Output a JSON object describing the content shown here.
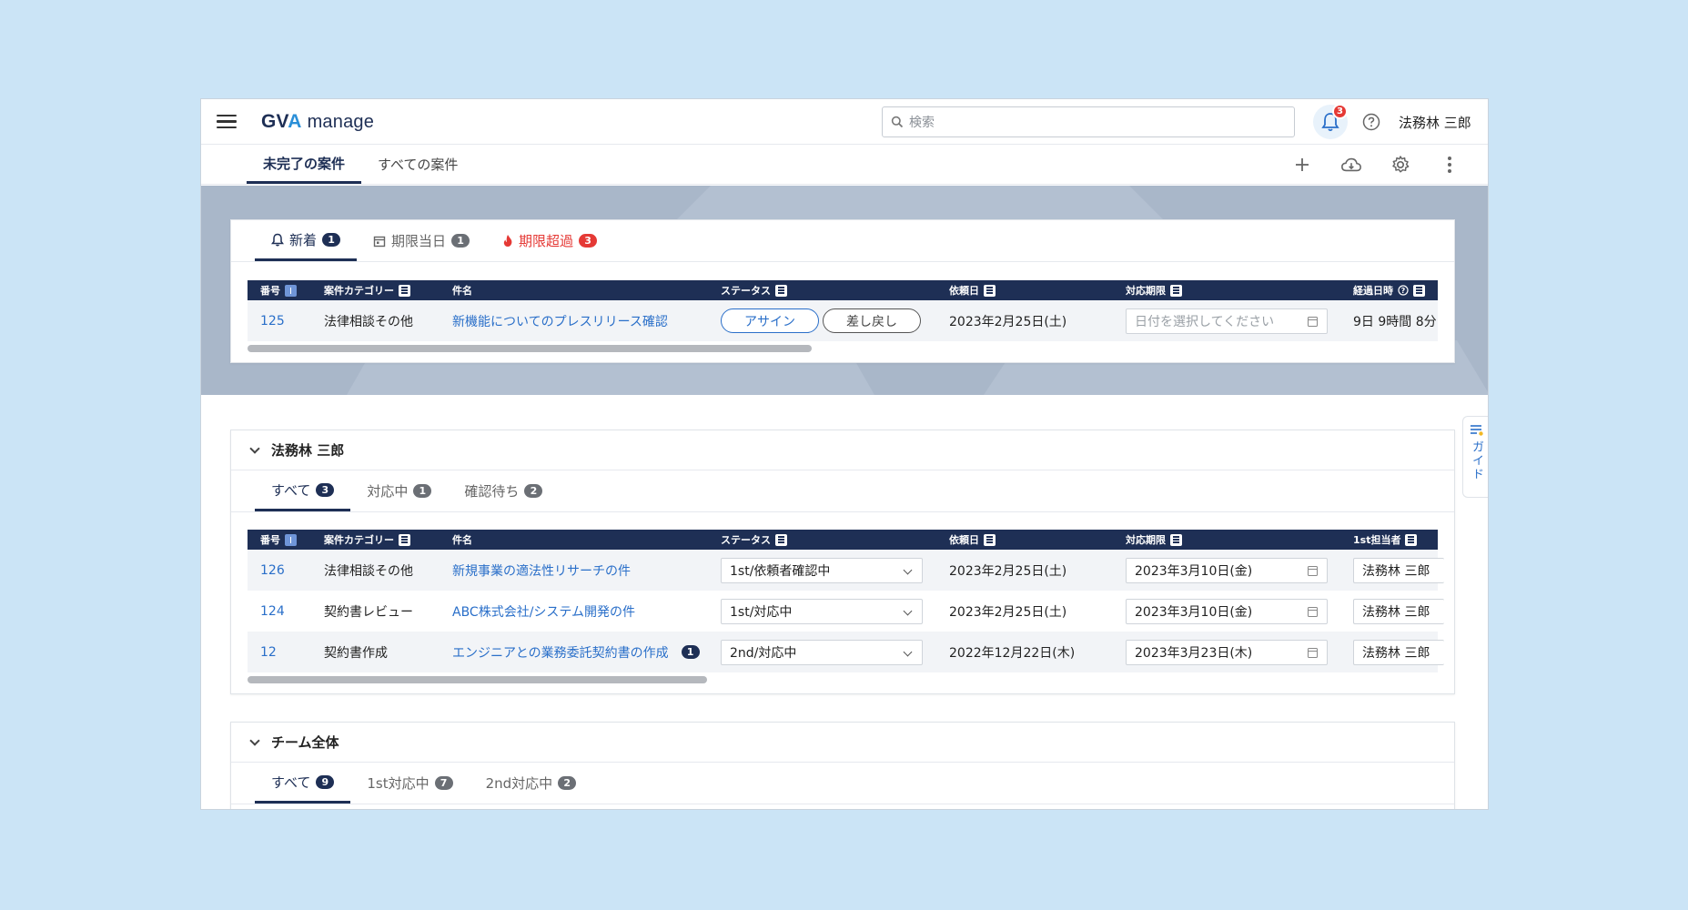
{
  "app": {
    "logo_gv": "GV",
    "logo_a": "A",
    "logo_manage": "manage",
    "search_placeholder": "検索",
    "notification_count": "3",
    "user_name": "法務林 三郎"
  },
  "main_tabs": [
    {
      "label": "未完了の案件",
      "active": true
    },
    {
      "label": "すべての案件",
      "active": false
    }
  ],
  "toolbar": {
    "icons": [
      "plus-icon",
      "cloud-download-icon",
      "gear-icon",
      "more-vertical-icon"
    ]
  },
  "top_card": {
    "tabs": [
      {
        "label": "新着",
        "count": "1",
        "icon": "bell-icon"
      },
      {
        "label": "期限当日",
        "count": "1",
        "icon": "calendar-icon"
      },
      {
        "label": "期限超過",
        "count": "3",
        "icon": "fire-icon"
      }
    ],
    "columns": [
      "番号",
      "案件カテゴリー",
      "件名",
      "ステータス",
      "依頼日",
      "対応期限",
      "経過日時"
    ],
    "rows": [
      {
        "number": "125",
        "category": "法律相談その他",
        "title": "新機能についてのプレスリリース確認",
        "assign_label": "アサイン",
        "reject_label": "差し戻し",
        "request_date": "2023年2月25日(土)",
        "deadline_placeholder": "日付を選択してください",
        "elapsed": "9日 9時間 8分"
      }
    ]
  },
  "user_section": {
    "title": "法務林 三郎",
    "tabs": [
      {
        "label": "すべて",
        "count": "3"
      },
      {
        "label": "対応中",
        "count": "1"
      },
      {
        "label": "確認待ち",
        "count": "2"
      }
    ],
    "columns": [
      "番号",
      "案件カテゴリー",
      "件名",
      "ステータス",
      "依頼日",
      "対応期限",
      "1st担当者"
    ],
    "rows": [
      {
        "number": "126",
        "category": "法律相談その他",
        "title": "新規事業の適法性リサーチの件",
        "badge": "",
        "status": "1st/依頼者確認中",
        "request_date": "2023年2月25日(土)",
        "deadline": "2023年3月10日(金)",
        "assignee": "法務林 三郎"
      },
      {
        "number": "124",
        "category": "契約書レビュー",
        "title": "ABC株式会社/システム開発の件",
        "badge": "",
        "status": "1st/対応中",
        "request_date": "2023年2月25日(土)",
        "deadline": "2023年3月10日(金)",
        "assignee": "法務林 三郎"
      },
      {
        "number": "12",
        "category": "契約書作成",
        "title": "エンジニアとの業務委託契約書の作成",
        "badge": "1",
        "status": "2nd/対応中",
        "request_date": "2022年12月22日(木)",
        "deadline": "2023年3月23日(木)",
        "assignee": "法務林 三郎"
      }
    ]
  },
  "team_section": {
    "title": "チーム全体",
    "tabs": [
      {
        "label": "すべて",
        "count": "9"
      },
      {
        "label": "1st対応中",
        "count": "7"
      },
      {
        "label": "2nd対応中",
        "count": "2"
      }
    ]
  },
  "guide": {
    "label": "ガイド"
  },
  "colors": {
    "navy": "#1e2f55",
    "link": "#2a6fc9",
    "alert": "#e53935",
    "background": "#cbe4f6"
  }
}
